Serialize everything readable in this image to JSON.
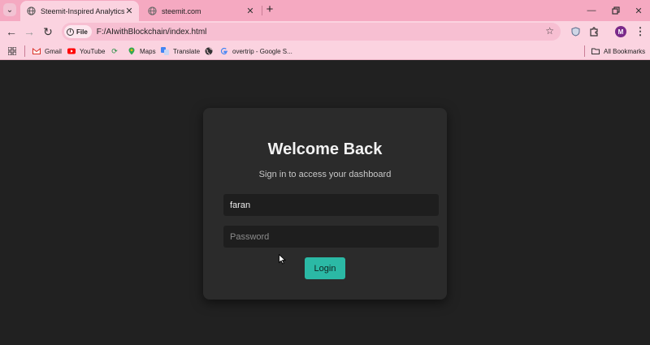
{
  "browser": {
    "tabs": [
      {
        "title": "Steemit-Inspired Analytics Dash",
        "active": true
      },
      {
        "title": "steemit.com",
        "active": false
      }
    ],
    "address": {
      "scheme_label": "File",
      "url": "F:/AIwithBlockchain/index.html"
    },
    "profile_initial": "M",
    "bookmarks": [
      {
        "label": "Gmail",
        "icon": "gmail-icon"
      },
      {
        "label": "YouTube",
        "icon": "youtube-icon"
      },
      {
        "label": "",
        "icon": "sync-icon"
      },
      {
        "label": "Maps",
        "icon": "maps-icon"
      },
      {
        "label": "Translate",
        "icon": "translate-icon"
      },
      {
        "label": "",
        "icon": "globe-icon"
      },
      {
        "label": "overtrip - Google S...",
        "icon": "google-icon"
      }
    ],
    "all_bookmarks_label": "All Bookmarks"
  },
  "login": {
    "title": "Welcome Back",
    "subtitle": "Sign in to access your dashboard",
    "username_value": "faran",
    "password_placeholder": "Password",
    "button_label": "Login"
  },
  "colors": {
    "chrome": "#f5a9c1",
    "page_background": "#212121",
    "card_background": "#2b2b2b",
    "accent": "#2bb9a5"
  }
}
